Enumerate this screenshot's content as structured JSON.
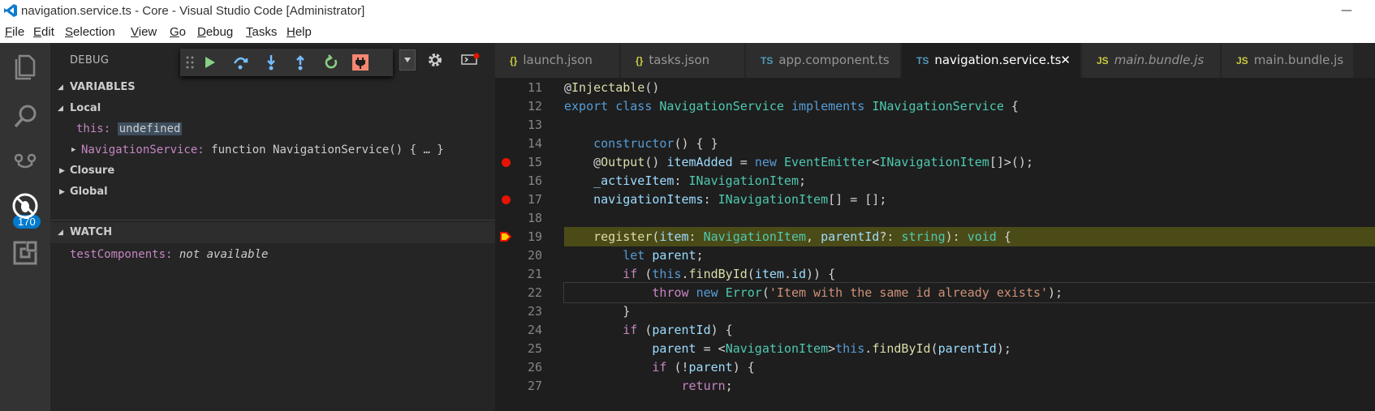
{
  "window": {
    "title": "navigation.service.ts - Core - Visual Studio Code [Administrator]",
    "min_glyph": "—"
  },
  "menu": [
    "File",
    "Edit",
    "Selection",
    "View",
    "Go",
    "Debug",
    "Tasks",
    "Help"
  ],
  "activity": {
    "badge": "170"
  },
  "sidebar": {
    "title": "DEBUG",
    "variables_title": "VARIABLES",
    "local_label": "Local",
    "this_name": "this:",
    "this_value": "undefined",
    "navservice_name": "NavigationService:",
    "navservice_value": "function NavigationService() { … }",
    "closure_label": "Closure",
    "global_label": "Global",
    "watch_title": "WATCH",
    "watch_name": "testComponents:",
    "watch_value": "not available"
  },
  "tabs": [
    {
      "icon": "{}",
      "label": "launch.json"
    },
    {
      "icon": "{}",
      "label": "tasks.json"
    },
    {
      "icon": "TS",
      "label": "app.component.ts"
    },
    {
      "icon": "TS",
      "label": "navigation.service.ts",
      "close": "✕"
    },
    {
      "icon": "JS",
      "label": "main.bundle.js"
    },
    {
      "icon": "JS",
      "label": "main.bundle.js"
    }
  ],
  "code": {
    "line_numbers": [
      "11",
      "12",
      "13",
      "14",
      "15",
      "16",
      "17",
      "18",
      "19",
      "20",
      "21",
      "22",
      "23",
      "24",
      "25",
      "26",
      "27"
    ],
    "breakpoint_lines": [
      "15",
      "17"
    ],
    "current_line": "19"
  },
  "colors": {
    "accent": "#007acc",
    "breakpoint": "#e51400",
    "highlight": "#4b4b18",
    "keyword": "#569cd6",
    "type": "#4ec9b0",
    "string": "#ce9178"
  }
}
